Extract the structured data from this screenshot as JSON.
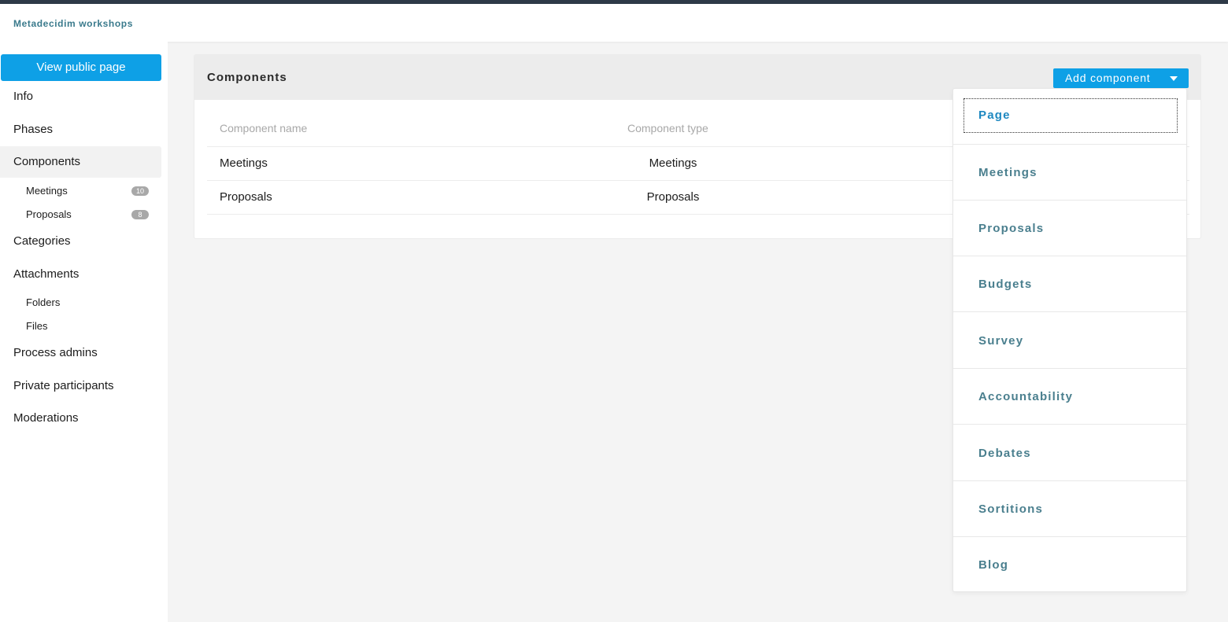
{
  "header": {
    "brand": "Metadecidim workshops"
  },
  "sidebar": {
    "view_public_label": "View public page",
    "items": [
      {
        "label": "Info"
      },
      {
        "label": "Phases"
      },
      {
        "label": "Components"
      },
      {
        "label": "Categories"
      },
      {
        "label": "Attachments"
      },
      {
        "label": "Process admins"
      },
      {
        "label": "Private participants"
      },
      {
        "label": "Moderations"
      }
    ],
    "components_sub": [
      {
        "label": "Meetings",
        "count": "10"
      },
      {
        "label": "Proposals",
        "count": "8"
      }
    ],
    "attachments_sub": [
      {
        "label": "Folders"
      },
      {
        "label": "Files"
      }
    ]
  },
  "main": {
    "title": "Components",
    "add_button_label": "Add component",
    "table": {
      "headers": [
        "Component name",
        "Component type"
      ],
      "rows": [
        [
          "Meetings",
          "Meetings"
        ],
        [
          "Proposals",
          "Proposals"
        ]
      ]
    },
    "dropdown": {
      "items": [
        {
          "label": "Page"
        },
        {
          "label": "Meetings"
        },
        {
          "label": "Proposals"
        },
        {
          "label": "Budgets"
        },
        {
          "label": "Survey"
        },
        {
          "label": "Accountability"
        },
        {
          "label": "Debates"
        },
        {
          "label": "Sortitions"
        },
        {
          "label": "Blog"
        }
      ]
    }
  },
  "colors": {
    "accent": "#0ea0e6",
    "dropdown_text": "#4a7f8e",
    "brand_text": "#3a7a8c"
  }
}
